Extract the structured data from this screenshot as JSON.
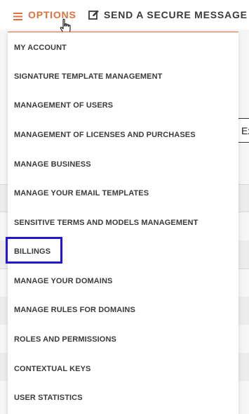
{
  "topbar": {
    "options_label": "OPTIONS",
    "send_label": "SEND A SECURE MESSAGE"
  },
  "background": {
    "input_partial_text": "Ex"
  },
  "menu": {
    "items": [
      {
        "label": "MY ACCOUNT"
      },
      {
        "label": "SIGNATURE TEMPLATE MANAGEMENT"
      },
      {
        "label": "MANAGEMENT OF USERS"
      },
      {
        "label": "MANAGEMENT OF LICENSES AND PURCHASES"
      },
      {
        "label": "MANAGE BUSINESS"
      },
      {
        "label": "MANAGE YOUR EMAIL TEMPLATES"
      },
      {
        "label": "SENSITIVE TERMS AND MODELS MANAGEMENT"
      },
      {
        "label": "BILLINGS"
      },
      {
        "label": "MANAGE YOUR DOMAINS"
      },
      {
        "label": "MANAGE RULES FOR DOMAINS"
      },
      {
        "label": "ROLES AND PERMISSIONS"
      },
      {
        "label": "CONTEXTUAL KEYS"
      },
      {
        "label": "USER STATISTICS"
      }
    ],
    "highlighted_item": "BILLINGS"
  },
  "colors": {
    "accent": "#e0703a",
    "highlight": "#2418c9",
    "text": "#3b3b3b"
  },
  "icons": {
    "options": "hamburger-menu-icon",
    "send": "edit-icon",
    "pointer": "hand-cursor-icon"
  }
}
